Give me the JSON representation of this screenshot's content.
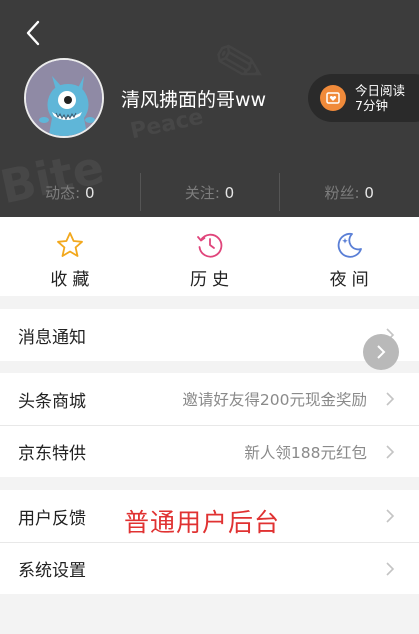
{
  "header": {
    "username": "清风拂面的哥ww",
    "read_badge": {
      "line1": "今日阅读",
      "line2": "7分钟"
    },
    "stats": [
      {
        "label": "动态:",
        "value": "0"
      },
      {
        "label": "关注:",
        "value": "0"
      },
      {
        "label": "粉丝:",
        "value": "0"
      }
    ]
  },
  "quick_actions": [
    {
      "label": "收藏",
      "icon": "star-icon",
      "color": "#f2a81d"
    },
    {
      "label": "历史",
      "icon": "history-icon",
      "color": "#e0457b"
    },
    {
      "label": "夜间",
      "icon": "moon-icon",
      "color": "#5a7fd6"
    }
  ],
  "menu": {
    "notifications": {
      "label": "消息通知"
    },
    "mall": {
      "label": "头条商城",
      "extra": "邀请好友得200元现金奖励"
    },
    "jd": {
      "label": "京东特供",
      "extra": "新人领188元红包"
    },
    "feedback": {
      "label": "用户反馈"
    },
    "settings": {
      "label": "系统设置"
    }
  },
  "overlay_caption": "普通用户后台",
  "colors": {
    "header_bg": "#3c3c3c",
    "caption_red": "#e03232",
    "read_badge_orange": "#f08a3a"
  }
}
